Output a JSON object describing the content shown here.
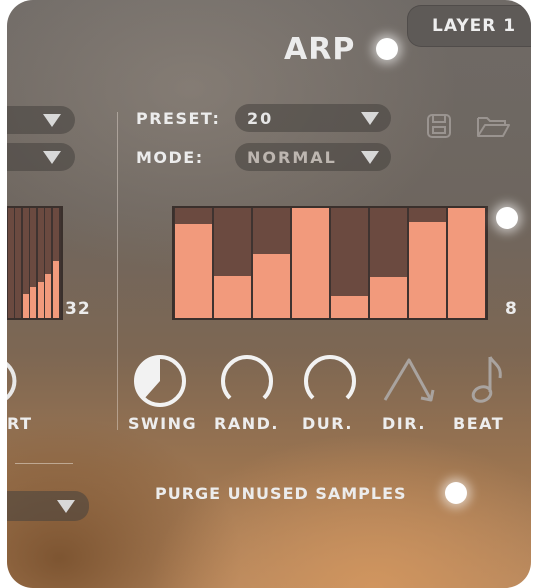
{
  "layer": {
    "label": "LAYER 1"
  },
  "arp": {
    "title": "ARP",
    "preset_label": "PRESET:",
    "preset_value": "20",
    "mode_label": "MODE:",
    "mode_value": "NORMAL",
    "step_count": "8",
    "steps": [
      0.85,
      0.38,
      0.58,
      1.0,
      0.2,
      0.37,
      0.87,
      1.0
    ],
    "controls": [
      "SWING",
      "RAND.",
      "DUR.",
      "DIR.",
      "BEAT"
    ],
    "purge_label": "PURGE UNUSED SAMPLES"
  },
  "left_panel": {
    "step_count": "32",
    "label_fragment": "RT",
    "steps": [
      0.0,
      0.0,
      0.22,
      0.28,
      0.33,
      0.4,
      0.52
    ]
  },
  "colors": {
    "accent": "#f29a7c",
    "step_empty": "#6b4a40",
    "text": "#ececec"
  },
  "icons": {
    "save": "save-icon",
    "folder": "folder-icon",
    "swing": "swing-knob-icon",
    "rand": "rand-knob-icon",
    "dur": "dur-knob-icon",
    "dir": "direction-arrow-icon",
    "beat": "eighth-note-icon"
  }
}
